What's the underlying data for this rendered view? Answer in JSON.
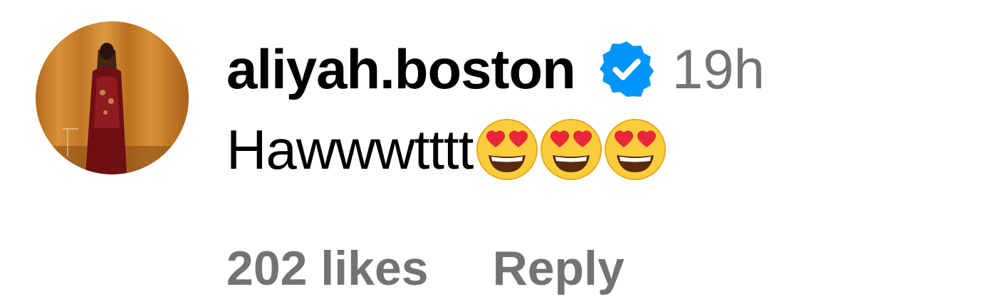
{
  "comment": {
    "username": "aliyah.boston",
    "verified": true,
    "timestamp": "19h",
    "text": "Hawwwtttt",
    "emojis": [
      "smiling-face-with-heart-eyes",
      "smiling-face-with-heart-eyes",
      "smiling-face-with-heart-eyes"
    ],
    "likes_label": "202 likes",
    "reply_label": "Reply"
  },
  "colors": {
    "text_primary": "#000000",
    "text_secondary": "#737373",
    "verified_blue": "#0095f6",
    "avatar_background": "#c9862f"
  }
}
